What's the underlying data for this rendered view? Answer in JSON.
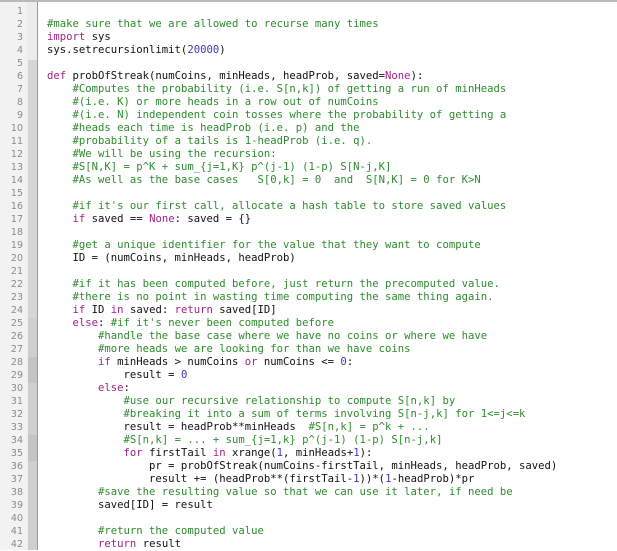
{
  "editor": {
    "language": "python",
    "colors": {
      "comment": "#2e8b2e",
      "keyword": "#a2208a",
      "number": "#3b3bb8",
      "plain": "#111111",
      "gutter_bg": "#f2f2f2",
      "line_number": "#8a8a8a"
    },
    "lines": [
      {
        "n": "1",
        "tokens": []
      },
      {
        "n": "2",
        "tokens": [
          {
            "t": "comment",
            "v": "#make sure that we are allowed to recurse many times"
          }
        ]
      },
      {
        "n": "3",
        "tokens": [
          {
            "t": "keyword",
            "v": "import"
          },
          {
            "t": "plain",
            "v": " sys"
          }
        ]
      },
      {
        "n": "4",
        "tokens": [
          {
            "t": "plain",
            "v": "sys.setrecursionlimit("
          },
          {
            "t": "number",
            "v": "20000"
          },
          {
            "t": "plain",
            "v": ")"
          }
        ]
      },
      {
        "n": "5",
        "tokens": []
      },
      {
        "n": "6",
        "tokens": [
          {
            "t": "keyword",
            "v": "def"
          },
          {
            "t": "plain",
            "v": " probOfStreak(numCoins, minHeads, headProb, saved="
          },
          {
            "t": "keyword",
            "v": "None"
          },
          {
            "t": "plain",
            "v": "):"
          }
        ]
      },
      {
        "n": "7",
        "tokens": [
          {
            "t": "plain",
            "v": "    "
          },
          {
            "t": "comment",
            "v": "#Computes the probability (i.e. S[n,k]) of getting a run of minHeads"
          }
        ]
      },
      {
        "n": "8",
        "tokens": [
          {
            "t": "plain",
            "v": "    "
          },
          {
            "t": "comment",
            "v": "#(i.e. K) or more heads in a row out of numCoins"
          }
        ]
      },
      {
        "n": "9",
        "tokens": [
          {
            "t": "plain",
            "v": "    "
          },
          {
            "t": "comment",
            "v": "#(i.e. N) independent coin tosses where the probability of getting a"
          }
        ]
      },
      {
        "n": "10",
        "tokens": [
          {
            "t": "plain",
            "v": "    "
          },
          {
            "t": "comment",
            "v": "#heads each time is headProb (i.e. p) and the"
          }
        ]
      },
      {
        "n": "11",
        "tokens": [
          {
            "t": "plain",
            "v": "    "
          },
          {
            "t": "comment",
            "v": "#probability of a tails is 1-headProb (i.e. q)."
          }
        ]
      },
      {
        "n": "12",
        "tokens": [
          {
            "t": "plain",
            "v": "    "
          },
          {
            "t": "comment",
            "v": "#We will be using the recursion:"
          }
        ]
      },
      {
        "n": "13",
        "tokens": [
          {
            "t": "plain",
            "v": "    "
          },
          {
            "t": "comment",
            "v": "#S[N,K] = p^K + sum_{j=1,K} p^(j-1) (1-p) S[N-j,K]"
          }
        ]
      },
      {
        "n": "14",
        "tokens": [
          {
            "t": "plain",
            "v": "    "
          },
          {
            "t": "comment",
            "v": "#As well as the base cases   S[0,k] = 0  and  S[N,K] = 0 for K>N"
          }
        ]
      },
      {
        "n": "15",
        "tokens": []
      },
      {
        "n": "16",
        "tokens": [
          {
            "t": "plain",
            "v": "    "
          },
          {
            "t": "comment",
            "v": "#if it's our first call, allocate a hash table to store saved values"
          }
        ]
      },
      {
        "n": "17",
        "tokens": [
          {
            "t": "plain",
            "v": "    "
          },
          {
            "t": "keyword",
            "v": "if"
          },
          {
            "t": "plain",
            "v": " saved == "
          },
          {
            "t": "keyword",
            "v": "None"
          },
          {
            "t": "plain",
            "v": ": saved = {}"
          }
        ]
      },
      {
        "n": "18",
        "tokens": []
      },
      {
        "n": "19",
        "tokens": [
          {
            "t": "plain",
            "v": "    "
          },
          {
            "t": "comment",
            "v": "#get a unique identifier for the value that they want to compute"
          }
        ]
      },
      {
        "n": "20",
        "tokens": [
          {
            "t": "plain",
            "v": "    ID = (numCoins, minHeads, headProb)"
          }
        ]
      },
      {
        "n": "21",
        "tokens": []
      },
      {
        "n": "22",
        "tokens": [
          {
            "t": "plain",
            "v": "    "
          },
          {
            "t": "comment",
            "v": "#if it has been computed before, just return the precomputed value."
          }
        ]
      },
      {
        "n": "23",
        "tokens": [
          {
            "t": "plain",
            "v": "    "
          },
          {
            "t": "comment",
            "v": "#there is no point in wasting time computing the same thing again."
          }
        ]
      },
      {
        "n": "24",
        "tokens": [
          {
            "t": "plain",
            "v": "    "
          },
          {
            "t": "keyword",
            "v": "if"
          },
          {
            "t": "plain",
            "v": " ID "
          },
          {
            "t": "keyword",
            "v": "in"
          },
          {
            "t": "plain",
            "v": " saved: "
          },
          {
            "t": "keyword",
            "v": "return"
          },
          {
            "t": "plain",
            "v": " saved[ID]"
          }
        ]
      },
      {
        "n": "25",
        "tokens": [
          {
            "t": "plain",
            "v": "    "
          },
          {
            "t": "keyword",
            "v": "else"
          },
          {
            "t": "plain",
            "v": ": "
          },
          {
            "t": "comment",
            "v": "#if it's never been computed before"
          }
        ]
      },
      {
        "n": "26",
        "tokens": [
          {
            "t": "plain",
            "v": "        "
          },
          {
            "t": "comment",
            "v": "#handle the base case where we have no coins or where we have"
          }
        ]
      },
      {
        "n": "27",
        "tokens": [
          {
            "t": "plain",
            "v": "        "
          },
          {
            "t": "comment",
            "v": "#more heads we are looking for than we have coins"
          }
        ]
      },
      {
        "n": "28",
        "tokens": [
          {
            "t": "plain",
            "v": "        "
          },
          {
            "t": "keyword",
            "v": "if"
          },
          {
            "t": "plain",
            "v": " minHeads > numCoins "
          },
          {
            "t": "keyword",
            "v": "or"
          },
          {
            "t": "plain",
            "v": " numCoins <= "
          },
          {
            "t": "number",
            "v": "0"
          },
          {
            "t": "plain",
            "v": ":"
          }
        ]
      },
      {
        "n": "29",
        "tokens": [
          {
            "t": "plain",
            "v": "            result = "
          },
          {
            "t": "number",
            "v": "0"
          }
        ]
      },
      {
        "n": "30",
        "tokens": [
          {
            "t": "plain",
            "v": "        "
          },
          {
            "t": "keyword",
            "v": "else"
          },
          {
            "t": "plain",
            "v": ":"
          }
        ]
      },
      {
        "n": "31",
        "tokens": [
          {
            "t": "plain",
            "v": "            "
          },
          {
            "t": "comment",
            "v": "#use our recursive relationship to compute S[n,k] by"
          }
        ]
      },
      {
        "n": "32",
        "tokens": [
          {
            "t": "plain",
            "v": "            "
          },
          {
            "t": "comment",
            "v": "#breaking it into a sum of terms involving S[n-j,k] for 1<=j<=k"
          }
        ]
      },
      {
        "n": "33",
        "tokens": [
          {
            "t": "plain",
            "v": "            result = headProb**minHeads  "
          },
          {
            "t": "comment",
            "v": "#S[n,k] = p^k + ..."
          }
        ]
      },
      {
        "n": "34",
        "tokens": [
          {
            "t": "plain",
            "v": "            "
          },
          {
            "t": "comment",
            "v": "#S[n,k] = ... + sum_{j=1,k} p^(j-1) (1-p) S[n-j,k]"
          }
        ]
      },
      {
        "n": "35",
        "tokens": [
          {
            "t": "plain",
            "v": "            "
          },
          {
            "t": "keyword",
            "v": "for"
          },
          {
            "t": "plain",
            "v": " firstTail "
          },
          {
            "t": "keyword",
            "v": "in"
          },
          {
            "t": "plain",
            "v": " xrange("
          },
          {
            "t": "number",
            "v": "1"
          },
          {
            "t": "plain",
            "v": ", minHeads+"
          },
          {
            "t": "number",
            "v": "1"
          },
          {
            "t": "plain",
            "v": "):"
          }
        ]
      },
      {
        "n": "36",
        "tokens": [
          {
            "t": "plain",
            "v": "                pr = probOfStreak(numCoins-firstTail, minHeads, headProb, saved)"
          }
        ]
      },
      {
        "n": "37",
        "tokens": [
          {
            "t": "plain",
            "v": "                result += (headProb**(firstTail-"
          },
          {
            "t": "number",
            "v": "1"
          },
          {
            "t": "plain",
            "v": "))*("
          },
          {
            "t": "number",
            "v": "1"
          },
          {
            "t": "plain",
            "v": "-headProb)*pr"
          }
        ]
      },
      {
        "n": "38",
        "tokens": [
          {
            "t": "plain",
            "v": "        "
          },
          {
            "t": "comment",
            "v": "#save the resulting value so that we can use it later, if need be"
          }
        ]
      },
      {
        "n": "39",
        "tokens": [
          {
            "t": "plain",
            "v": "        saved[ID] = result"
          }
        ]
      },
      {
        "n": "40",
        "tokens": []
      },
      {
        "n": "41",
        "tokens": [
          {
            "t": "plain",
            "v": "        "
          },
          {
            "t": "comment",
            "v": "#return the computed value"
          }
        ]
      },
      {
        "n": "42",
        "tokens": [
          {
            "t": "plain",
            "v": "        "
          },
          {
            "t": "keyword",
            "v": "return"
          },
          {
            "t": "plain",
            "v": " result"
          }
        ]
      }
    ]
  }
}
